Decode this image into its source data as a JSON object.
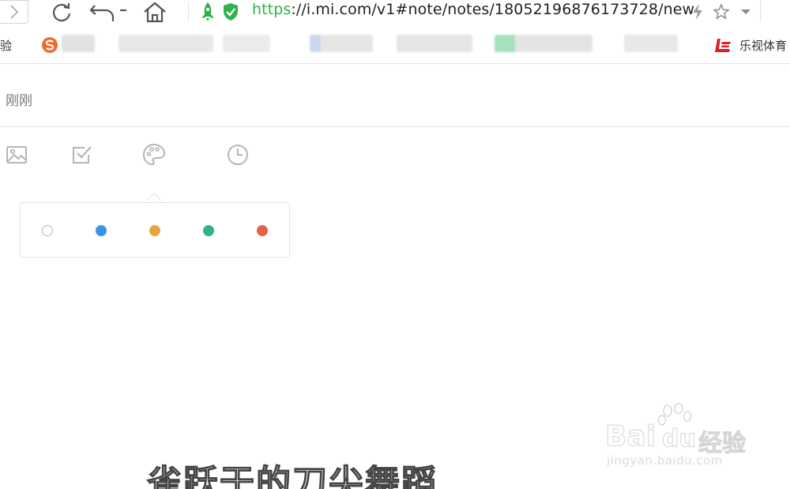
{
  "browser": {
    "url_scheme": "https",
    "url_rest": "://i.mi.com/v1#note/notes/18052196876173728/new",
    "icons": {
      "forward": "chevron-right-icon",
      "refresh": "refresh-icon",
      "undo": "undo-icon",
      "home": "home-icon",
      "rocket": "rocket-icon",
      "secure": "shield-check-icon",
      "lightning": "lightning-icon",
      "star": "star-icon",
      "menu": "chevron-down-icon"
    }
  },
  "bookmarks": {
    "left_partial": "验",
    "right_item": "乐视体育"
  },
  "note": {
    "timestamp": "刚刚",
    "toolbar": [
      "image-icon",
      "checkbox-icon",
      "palette-icon",
      "clock-icon"
    ],
    "palette": {
      "colors": [
        "#ffffff",
        "#3a93e4",
        "#e7a53e",
        "#2db583",
        "#e6604a"
      ]
    }
  },
  "overlay": {
    "caption": "雀跃于的刀尖舞蹈",
    "watermark_main": "Bai",
    "watermark_du": "du",
    "watermark_cn": "经验",
    "watermark_sub": "jingyan.baidu.com"
  }
}
